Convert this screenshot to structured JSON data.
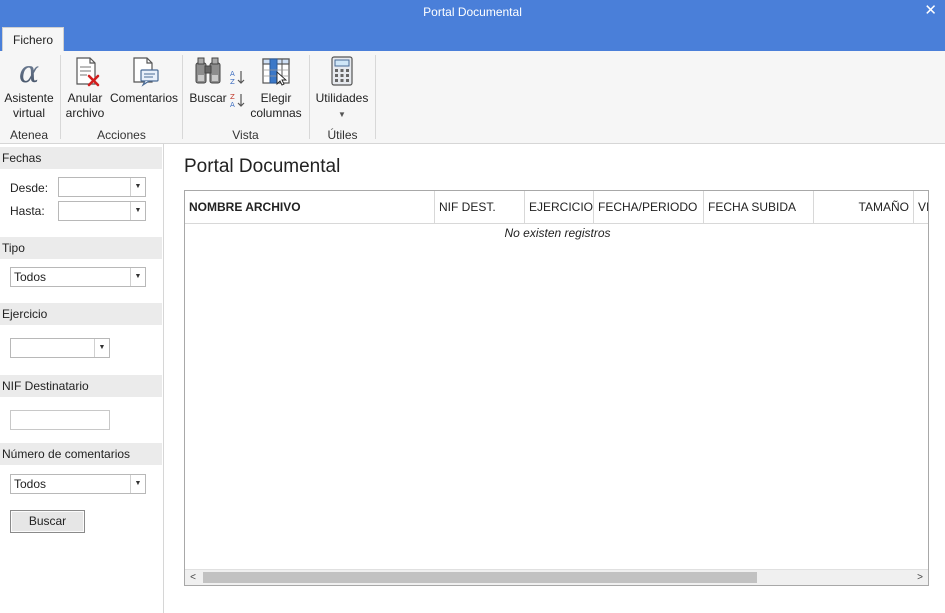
{
  "window": {
    "title": "Portal Documental",
    "close_glyph": "✕"
  },
  "tabs": [
    {
      "label": "Fichero"
    }
  ],
  "ribbon": {
    "groups": [
      {
        "label": "Atenea",
        "buttons": [
          {
            "label": "Asistente virtual",
            "icon": "alpha-icon"
          }
        ]
      },
      {
        "label": "Acciones",
        "buttons": [
          {
            "label": "Anular archivo",
            "icon": "cancel-document-icon"
          },
          {
            "label": "Comentarios",
            "icon": "comments-icon"
          }
        ]
      },
      {
        "label": "Vista",
        "buttons": [
          {
            "label": "Buscar",
            "icon": "binoculars-icon"
          },
          {
            "label": "Elegir columnas",
            "icon": "columns-icon"
          }
        ],
        "small_icons": [
          "sort-ascending-icon",
          "sort-descending-icon"
        ]
      },
      {
        "label": "Útiles",
        "buttons": [
          {
            "label": "Utilidades",
            "icon": "calculator-icon",
            "has_dropdown": true
          }
        ]
      }
    ]
  },
  "filters": {
    "fechas": {
      "section": "Fechas",
      "desde_label": "Desde:",
      "desde_value": "",
      "hasta_label": "Hasta:",
      "hasta_value": ""
    },
    "tipo": {
      "section": "Tipo",
      "value": "Todos"
    },
    "ejercicio": {
      "section": "Ejercicio",
      "value": ""
    },
    "nif": {
      "section": "NIF Destinatario",
      "value": ""
    },
    "comentarios": {
      "section": "Número de comentarios",
      "value": "Todos"
    },
    "search_button": "Buscar"
  },
  "main": {
    "title": "Portal Documental",
    "columns": [
      "NOMBRE ARCHIVO",
      "NIF DEST.",
      "EJERCICIO",
      "FECHA/PERIODO",
      "FECHA SUBIDA",
      "TAMAÑO",
      "VI"
    ],
    "empty_message": "No existen registros",
    "scroll_left": "<",
    "scroll_right": ">"
  },
  "colors": {
    "accent": "#4a7fd9",
    "ribbon_bg": "#f6f6f6",
    "section_bg": "#ebebeb"
  }
}
